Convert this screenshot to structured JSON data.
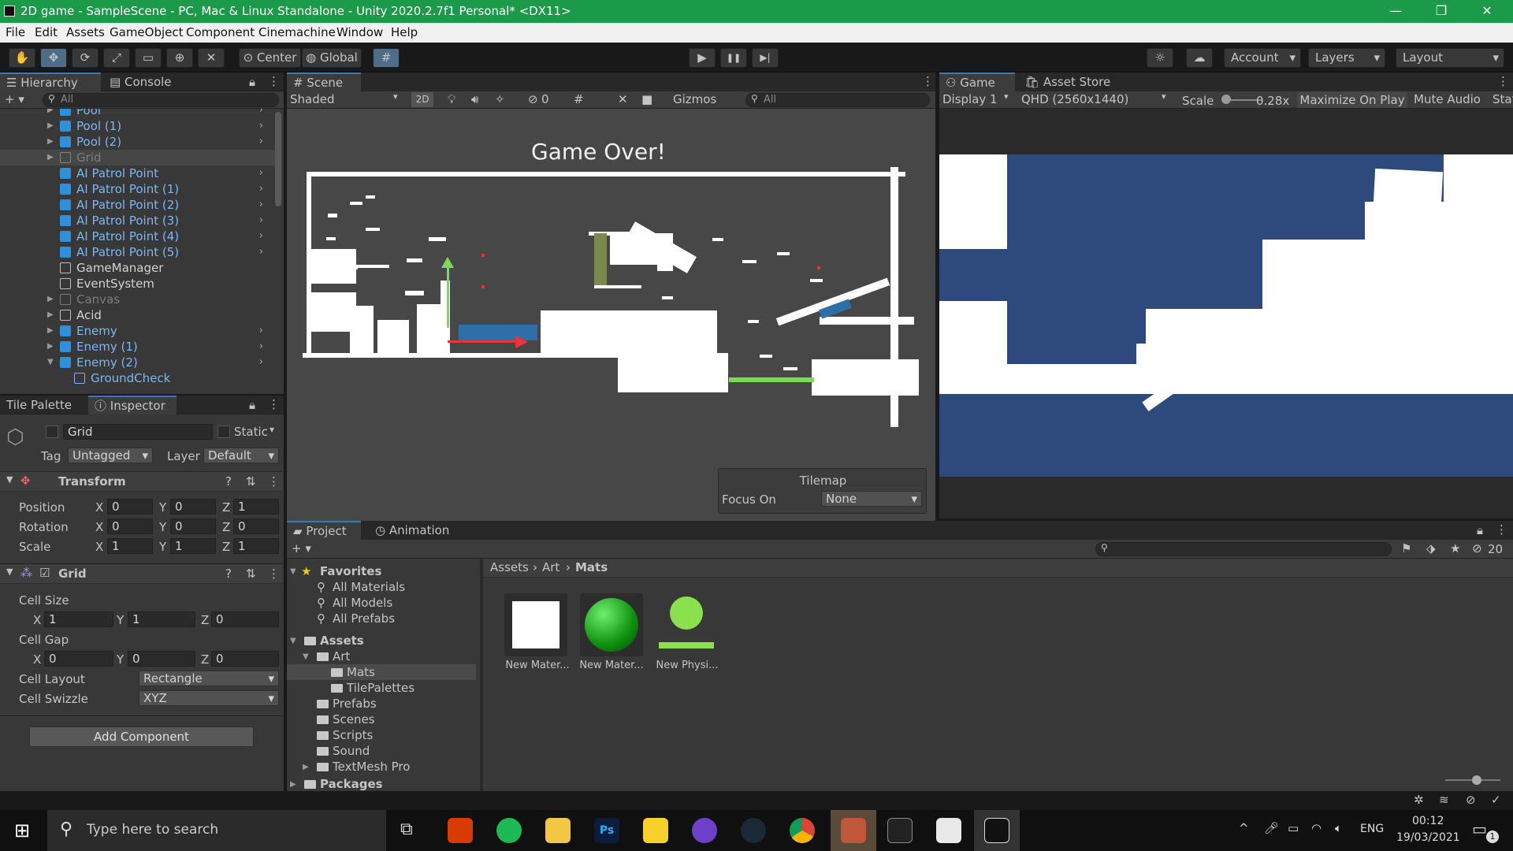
{
  "window": {
    "title": "2D game - SampleScene - PC, Mac & Linux Standalone - Unity 2020.2.7f1 Personal* <DX11>",
    "minimize": "—",
    "restore": "❐",
    "close": "✕"
  },
  "menu": [
    "File",
    "Edit",
    "Assets",
    "GameObject",
    "Component",
    "Cinemachine",
    "Window",
    "Help"
  ],
  "toolbar": {
    "center": "Center",
    "global": "Global",
    "play": "▶",
    "pause": "❚❚",
    "step": "▶|",
    "account": "Account",
    "layers": "Layers",
    "layout": "Layout"
  },
  "hierarchy": {
    "tab": "Hierarchy",
    "console_tab": "Console",
    "search_placeholder": "All",
    "add": "+ ▾",
    "items": [
      {
        "label": "Pool",
        "type": "prefab"
      },
      {
        "label": "Pool (1)",
        "type": "prefab"
      },
      {
        "label": "Pool (2)",
        "type": "prefab"
      },
      {
        "label": "Grid",
        "type": "inactive"
      },
      {
        "label": "AI Patrol Point",
        "type": "prefab"
      },
      {
        "label": "AI Patrol Point (1)",
        "type": "prefab"
      },
      {
        "label": "AI Patrol Point (2)",
        "type": "prefab"
      },
      {
        "label": "AI Patrol Point (3)",
        "type": "prefab"
      },
      {
        "label": "AI Patrol Point (4)",
        "type": "prefab"
      },
      {
        "label": "AI Patrol Point (5)",
        "type": "prefab"
      },
      {
        "label": "GameManager",
        "type": "object"
      },
      {
        "label": "EventSystem",
        "type": "object"
      },
      {
        "label": "Canvas",
        "type": "inactive"
      },
      {
        "label": "Acid",
        "type": "object"
      },
      {
        "label": "Enemy",
        "type": "prefab"
      },
      {
        "label": "Enemy (1)",
        "type": "prefab"
      },
      {
        "label": "Enemy (2)",
        "type": "prefab"
      },
      {
        "label": "GroundCheck",
        "type": "prefab"
      }
    ]
  },
  "inspector": {
    "tile_palette_tab": "Tile Palette",
    "tab": "Inspector",
    "object_name": "Grid",
    "static": "Static",
    "tag_label": "Tag",
    "tag": "Untagged",
    "layer_label": "Layer",
    "layer": "Default",
    "transform": {
      "title": "Transform",
      "position_label": "Position",
      "rotation_label": "Rotation",
      "scale_label": "Scale",
      "position": {
        "x": "0",
        "y": "0",
        "z": "1"
      },
      "rotation": {
        "x": "0",
        "y": "0",
        "z": "0"
      },
      "scale": {
        "x": "1",
        "y": "1",
        "z": "1"
      }
    },
    "grid": {
      "title": "Grid",
      "cell_size_label": "Cell Size",
      "cell_size": {
        "x": "1",
        "y": "1",
        "z": "0"
      },
      "cell_gap_label": "Cell Gap",
      "cell_gap": {
        "x": "0",
        "y": "0",
        "z": "0"
      },
      "cell_layout_label": "Cell Layout",
      "cell_layout": "Rectangle",
      "cell_swizzle_label": "Cell Swizzle",
      "cell_swizzle": "XYZ"
    },
    "add_component": "Add Component",
    "axis_x": "X",
    "axis_y": "Y",
    "axis_z": "Z"
  },
  "scene": {
    "tab": "Scene",
    "shading": "Shaded",
    "mode2d": "2D",
    "hidden_count": "0",
    "gizmos": "Gizmos",
    "search_placeholder": "All",
    "game_over": "Game Over!",
    "tilemap_overlay": {
      "title": "Tilemap",
      "focus_label": "Focus On",
      "focus_value": "None"
    }
  },
  "game": {
    "tab": "Game",
    "asset_store_tab": "Asset Store",
    "display": "Display 1",
    "resolution": "QHD (2560x1440)",
    "scale_label": "Scale",
    "scale_value": "0.28x",
    "maximize": "Maximize On Play",
    "mute": "Mute Audio",
    "stats": "Stats"
  },
  "project": {
    "tab": "Project",
    "animation_tab": "Animation",
    "add": "+ ▾",
    "hidden_count": "20",
    "favorites": {
      "label": "Favorites",
      "items": [
        "All Materials",
        "All Models",
        "All Prefabs"
      ]
    },
    "assets_label": "Assets",
    "art": "Art",
    "mats": "Mats",
    "tilepalettes": "TilePalettes",
    "folders": [
      "Prefabs",
      "Scenes",
      "Scripts",
      "Sound",
      "TextMesh Pro"
    ],
    "packages": "Packages",
    "breadcrumb": [
      "Assets",
      "Art",
      "Mats"
    ],
    "asset_items": [
      "New Mater...",
      "New Mater...",
      "New Physi..."
    ]
  },
  "taskbar": {
    "search_placeholder": "Type here to search",
    "lang": "ENG",
    "time": "00:12",
    "date": "19/03/2021",
    "notif": "1"
  },
  "colors": {
    "accent": "#3a79bb",
    "title_bar": "#1b9a4a",
    "game_bg": "#2e4a7d",
    "prefab_text": "#7cb6f2",
    "green_line": "#7ed957"
  }
}
